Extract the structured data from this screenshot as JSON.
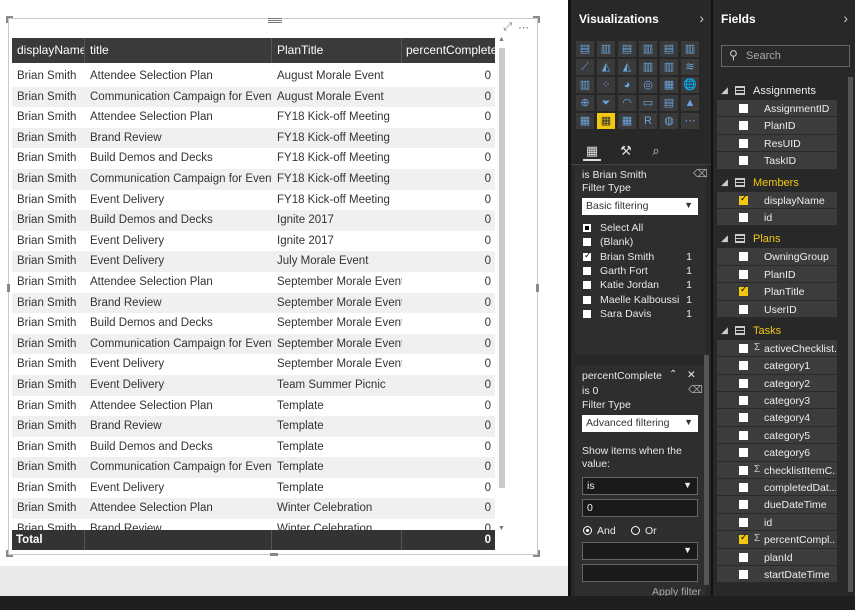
{
  "table": {
    "headers": [
      "displayName",
      "title",
      "PlanTitle",
      "percentComplete"
    ],
    "rows": [
      [
        "Brian Smith",
        "Attendee Selection Plan",
        "August Morale Event",
        "0"
      ],
      [
        "Brian Smith",
        "Communication Campaign for Event",
        "August Morale Event",
        "0"
      ],
      [
        "Brian Smith",
        "Attendee Selection Plan",
        "FY18 Kick-off Meeting",
        "0"
      ],
      [
        "Brian Smith",
        "Brand Review",
        "FY18 Kick-off Meeting",
        "0"
      ],
      [
        "Brian Smith",
        "Build Demos and Decks",
        "FY18 Kick-off Meeting",
        "0"
      ],
      [
        "Brian Smith",
        "Communication Campaign for Event",
        "FY18 Kick-off Meeting",
        "0"
      ],
      [
        "Brian Smith",
        "Event Delivery",
        "FY18 Kick-off Meeting",
        "0"
      ],
      [
        "Brian Smith",
        "Build Demos and Decks",
        "Ignite 2017",
        "0"
      ],
      [
        "Brian Smith",
        "Event Delivery",
        "Ignite 2017",
        "0"
      ],
      [
        "Brian Smith",
        "Event Delivery",
        "July Morale Event",
        "0"
      ],
      [
        "Brian Smith",
        "Attendee Selection Plan",
        "September Morale Event",
        "0"
      ],
      [
        "Brian Smith",
        "Brand Review",
        "September Morale Event",
        "0"
      ],
      [
        "Brian Smith",
        "Build Demos and Decks",
        "September Morale Event",
        "0"
      ],
      [
        "Brian Smith",
        "Communication Campaign for Event",
        "September Morale Event",
        "0"
      ],
      [
        "Brian Smith",
        "Event Delivery",
        "September Morale Event",
        "0"
      ],
      [
        "Brian Smith",
        "Event Delivery",
        "Team Summer Picnic",
        "0"
      ],
      [
        "Brian Smith",
        "Attendee Selection Plan",
        "Template",
        "0"
      ],
      [
        "Brian Smith",
        "Brand Review",
        "Template",
        "0"
      ],
      [
        "Brian Smith",
        "Build Demos and Decks",
        "Template",
        "0"
      ],
      [
        "Brian Smith",
        "Communication Campaign for Event",
        "Template",
        "0"
      ],
      [
        "Brian Smith",
        "Event Delivery",
        "Template",
        "0"
      ],
      [
        "Brian Smith",
        "Attendee Selection Plan",
        "Winter Celebration",
        "0"
      ],
      [
        "Brian Smith",
        "Brand Review",
        "Winter Celebration",
        "0"
      ]
    ],
    "total_label": "Total",
    "total_value": "0"
  },
  "visualizations": {
    "title": "Visualizations",
    "filter1": {
      "is_text": "is Brian Smith",
      "filter_type_label": "Filter Type",
      "filter_type_value": "Basic filtering",
      "items": [
        {
          "label": "Select All",
          "count": "",
          "state": "partial"
        },
        {
          "label": "(Blank)",
          "count": "",
          "state": "off"
        },
        {
          "label": "Brian Smith",
          "count": "1",
          "state": "on"
        },
        {
          "label": "Garth Fort",
          "count": "1",
          "state": "off"
        },
        {
          "label": "Katie Jordan",
          "count": "1",
          "state": "off"
        },
        {
          "label": "Maelle Kalboussi",
          "count": "1",
          "state": "off"
        },
        {
          "label": "Sara Davis",
          "count": "1",
          "state": "off"
        }
      ]
    },
    "filter2": {
      "field": "percentComplete",
      "is_text": "is 0",
      "filter_type_label": "Filter Type",
      "filter_type_value": "Advanced filtering",
      "show_items_label": "Show items when the value:",
      "operator": "is",
      "value": "0",
      "and_label": "And",
      "or_label": "Or",
      "apply_label": "Apply filter"
    }
  },
  "fields": {
    "title": "Fields",
    "search_placeholder": "Search",
    "tables": [
      {
        "name": "Assignments",
        "selected": false,
        "fields": [
          {
            "name": "AssignmentID",
            "checked": false,
            "sigma": false
          },
          {
            "name": "PlanID",
            "checked": false,
            "sigma": false
          },
          {
            "name": "ResUID",
            "checked": false,
            "sigma": false
          },
          {
            "name": "TaskID",
            "checked": false,
            "sigma": false
          }
        ]
      },
      {
        "name": "Members",
        "selected": true,
        "fields": [
          {
            "name": "displayName",
            "checked": true,
            "sigma": false
          },
          {
            "name": "id",
            "checked": false,
            "sigma": false
          }
        ]
      },
      {
        "name": "Plans",
        "selected": true,
        "fields": [
          {
            "name": "OwningGroup",
            "checked": false,
            "sigma": false
          },
          {
            "name": "PlanID",
            "checked": false,
            "sigma": false
          },
          {
            "name": "PlanTitle",
            "checked": true,
            "sigma": false
          },
          {
            "name": "UserID",
            "checked": false,
            "sigma": false
          }
        ]
      },
      {
        "name": "Tasks",
        "selected": true,
        "fields": [
          {
            "name": "activeChecklist...",
            "checked": false,
            "sigma": true
          },
          {
            "name": "category1",
            "checked": false,
            "sigma": false
          },
          {
            "name": "category2",
            "checked": false,
            "sigma": false
          },
          {
            "name": "category3",
            "checked": false,
            "sigma": false
          },
          {
            "name": "category4",
            "checked": false,
            "sigma": false
          },
          {
            "name": "category5",
            "checked": false,
            "sigma": false
          },
          {
            "name": "category6",
            "checked": false,
            "sigma": false
          },
          {
            "name": "checklistItemC...",
            "checked": false,
            "sigma": true
          },
          {
            "name": "completedDat...",
            "checked": false,
            "sigma": false
          },
          {
            "name": "dueDateTime",
            "checked": false,
            "sigma": false
          },
          {
            "name": "id",
            "checked": false,
            "sigma": false
          },
          {
            "name": "percentCompl...",
            "checked": true,
            "sigma": true
          },
          {
            "name": "planId",
            "checked": false,
            "sigma": false
          },
          {
            "name": "startDateTime",
            "checked": false,
            "sigma": false
          }
        ]
      }
    ]
  },
  "colors": {
    "accent": "#f2c811",
    "header_bg": "#3a3a3a",
    "pane_bg": "#282828"
  }
}
